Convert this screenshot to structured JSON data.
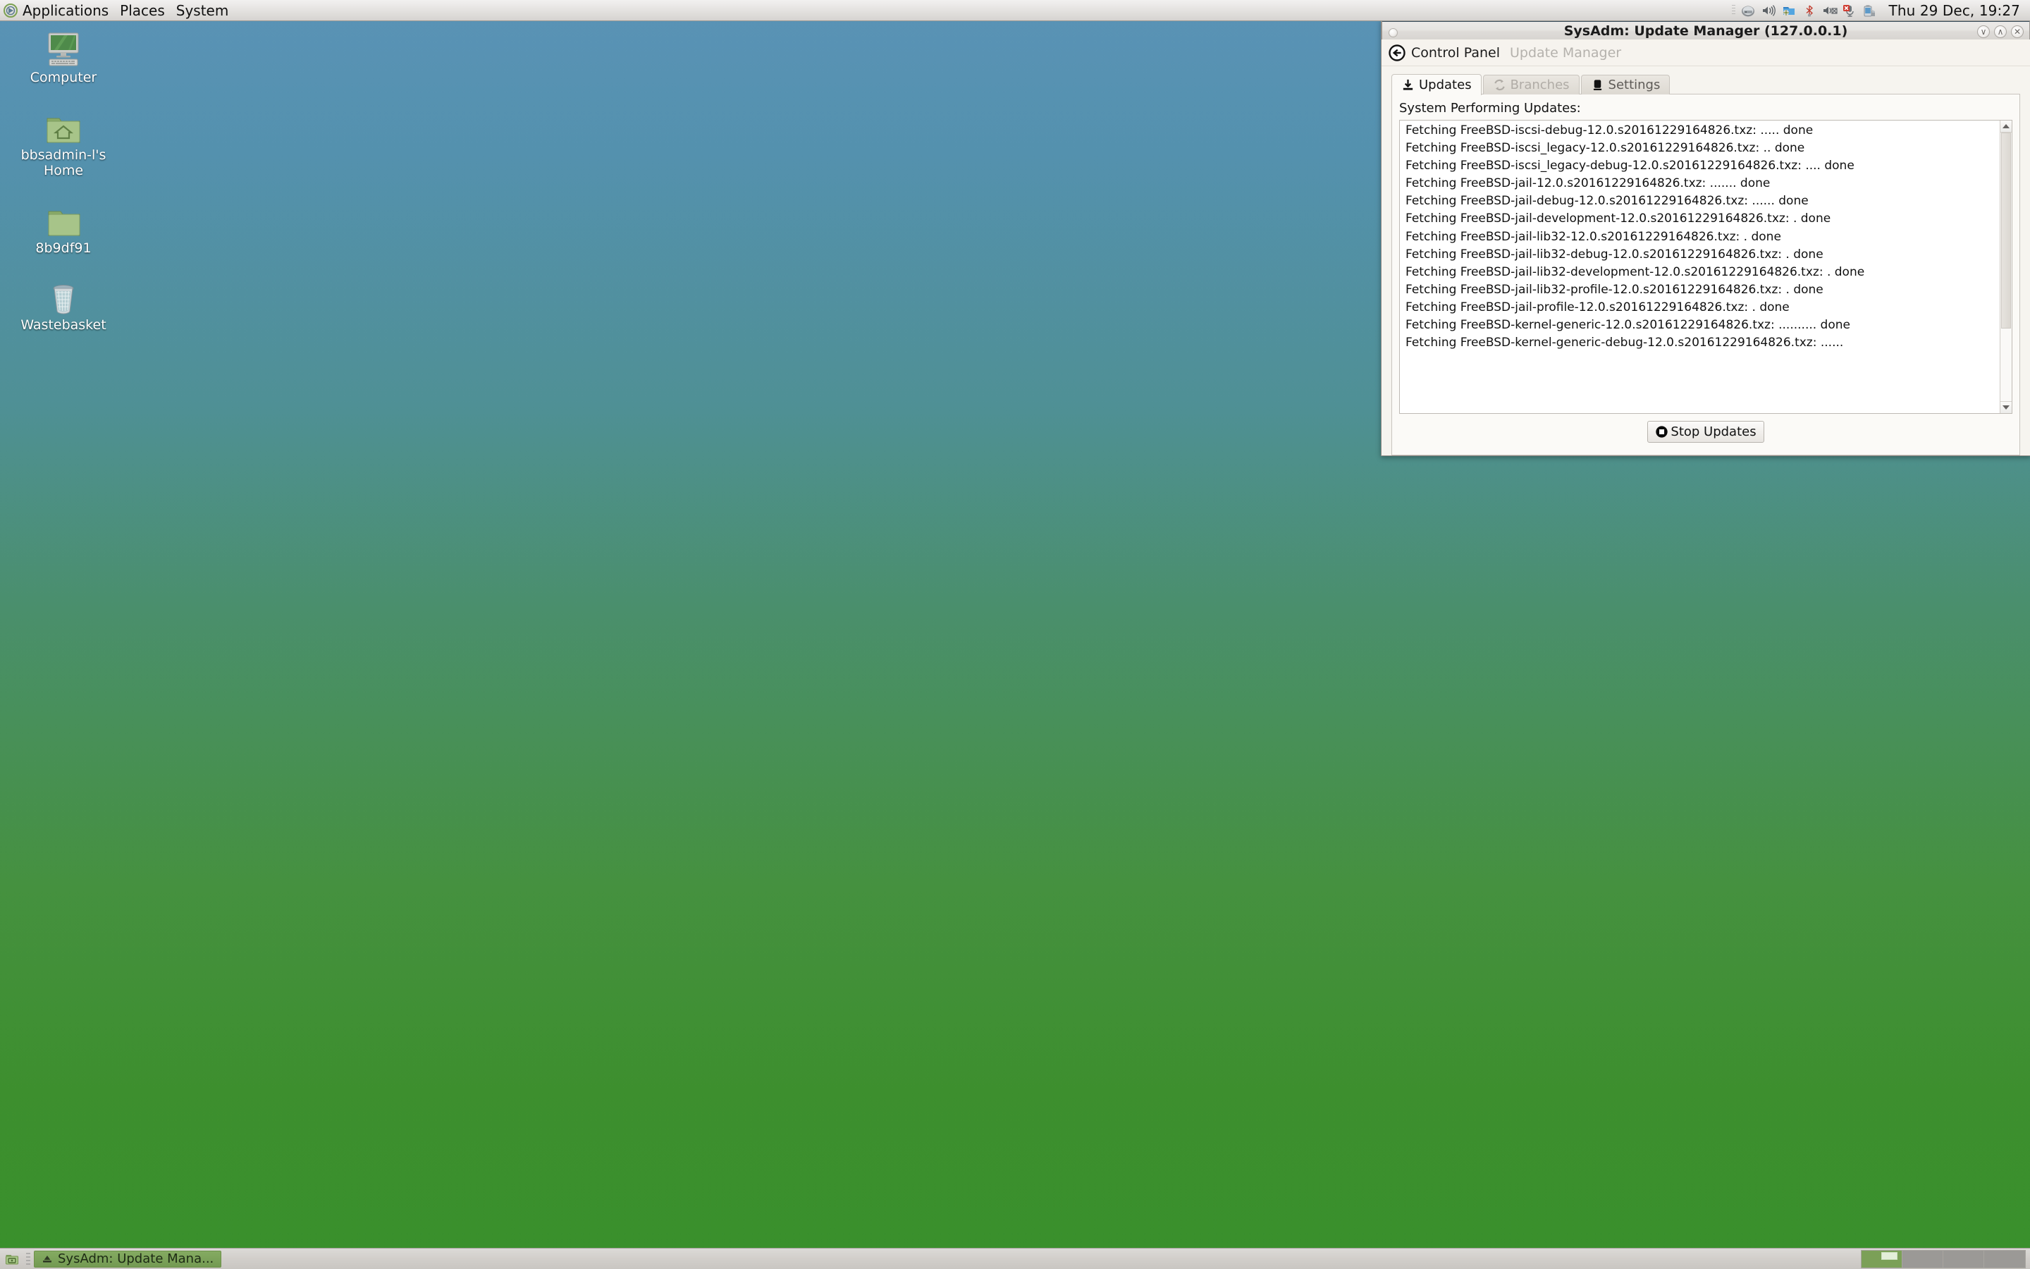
{
  "top_panel": {
    "logo_icon": "distro-logo-icon",
    "menus": [
      "Applications",
      "Places",
      "System"
    ],
    "tray_icons": [
      "disk-drive-icon",
      "volume-high-icon",
      "software-update-icon",
      "bluetooth-icon",
      "volume-muted-icon",
      "microphone-muted-icon",
      "battery-icon"
    ],
    "clock": "Thu 29 Dec, 19:27"
  },
  "desktop": {
    "icons": [
      {
        "label": "Computer",
        "icon": "computer-monitor-icon"
      },
      {
        "label": "bbsadmin-l's Home",
        "icon": "home-folder-icon"
      },
      {
        "label": "8b9df91",
        "icon": "folder-icon"
      },
      {
        "label": "Wastebasket",
        "icon": "trash-bin-icon"
      }
    ]
  },
  "window": {
    "title": "SysAdm: Update Manager (127.0.0.1)",
    "controls": {
      "minimize": "∨",
      "maximize": "∧",
      "close": "✕"
    },
    "breadcrumb": {
      "back_icon": "back-arrow-icon",
      "current": "Control Panel",
      "next": "Update Manager"
    },
    "tabs": [
      {
        "label": "Updates",
        "icon": "download-icon",
        "state": "active"
      },
      {
        "label": "Branches",
        "icon": "sync-refresh-icon",
        "state": "disabled"
      },
      {
        "label": "Settings",
        "icon": "hard-drive-icon",
        "state": "normal"
      }
    ],
    "panel_label": "System Performing Updates:",
    "log_lines": [
      "Fetching FreeBSD-iscsi-debug-12.0.s20161229164826.txz: ..... done",
      "Fetching FreeBSD-iscsi_legacy-12.0.s20161229164826.txz: .. done",
      "Fetching FreeBSD-iscsi_legacy-debug-12.0.s20161229164826.txz: .... done",
      "Fetching FreeBSD-jail-12.0.s20161229164826.txz: ....... done",
      "Fetching FreeBSD-jail-debug-12.0.s20161229164826.txz: ...... done",
      "Fetching FreeBSD-jail-development-12.0.s20161229164826.txz: . done",
      "Fetching FreeBSD-jail-lib32-12.0.s20161229164826.txz: . done",
      "Fetching FreeBSD-jail-lib32-debug-12.0.s20161229164826.txz: . done",
      "Fetching FreeBSD-jail-lib32-development-12.0.s20161229164826.txz: . done",
      "Fetching FreeBSD-jail-lib32-profile-12.0.s20161229164826.txz: . done",
      "Fetching FreeBSD-jail-profile-12.0.s20161229164826.txz: . done",
      "Fetching FreeBSD-kernel-generic-12.0.s20161229164826.txz: .......... done",
      "Fetching FreeBSD-kernel-generic-debug-12.0.s20161229164826.txz: ......"
    ],
    "stop_button": {
      "label": "Stop Updates",
      "icon": "stop-circle-icon"
    }
  },
  "bottom_panel": {
    "show_desktop_icon": "show-desktop-icon",
    "task_button": {
      "label": "SysAdm: Update Mana...",
      "icon": "app-window-icon"
    },
    "workspaces": [
      {
        "name": "workspace-1",
        "active": true
      },
      {
        "name": "workspace-2",
        "active": false
      },
      {
        "name": "workspace-3",
        "active": false
      },
      {
        "name": "workspace-4",
        "active": false
      }
    ]
  },
  "colors": {
    "desktop_top": "#5a93b6",
    "desktop_bottom": "#39902c",
    "panel_bg": "#e4e2e0",
    "window_bg": "#f6f4ef",
    "task_active": "#7ba057"
  }
}
